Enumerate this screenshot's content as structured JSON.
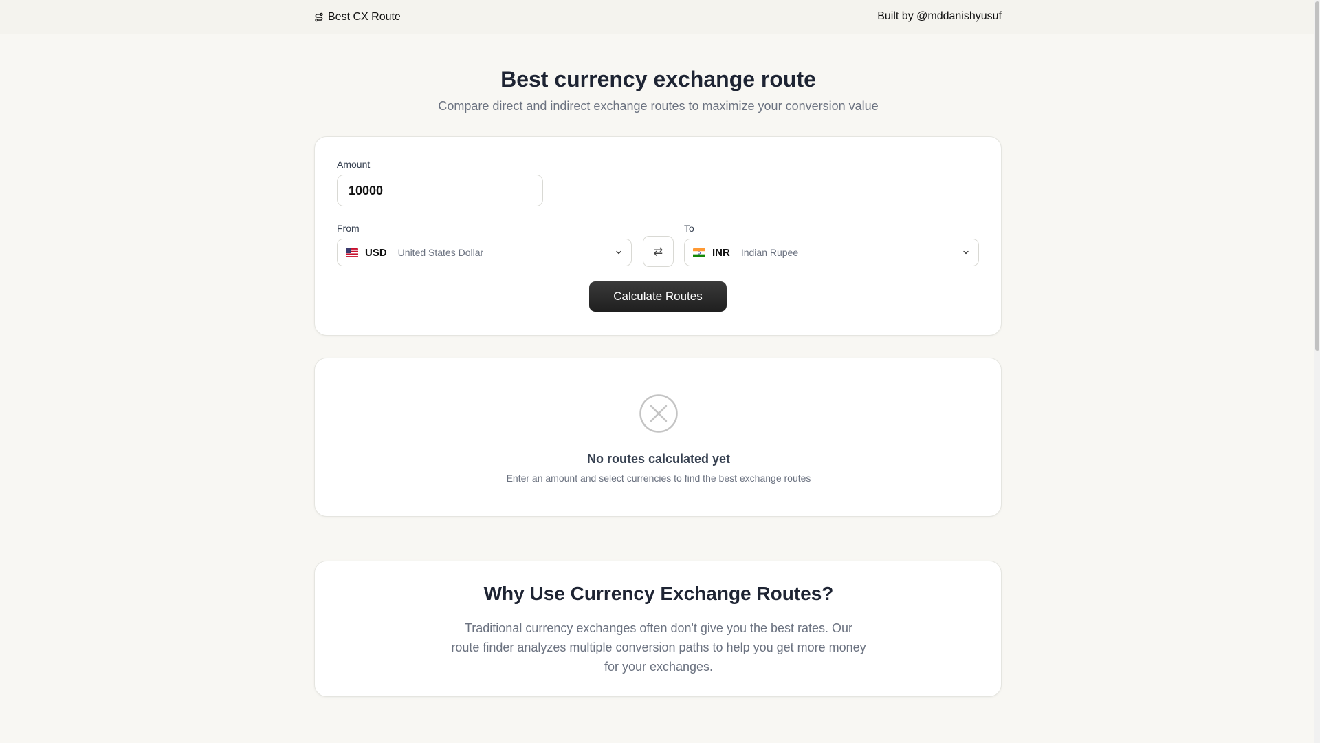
{
  "header": {
    "brand": "Best CX Route",
    "credit": "Built by @mddanishyusuf"
  },
  "hero": {
    "title": "Best currency exchange route",
    "subtitle": "Compare direct and indirect exchange routes to maximize your conversion value"
  },
  "form": {
    "amount_label": "Amount",
    "amount_value": "10000",
    "from_label": "From",
    "from_code": "USD",
    "from_name": "United States Dollar",
    "to_label": "To",
    "to_code": "INR",
    "to_name": "Indian Rupee",
    "swap_icon": "swap-arrows-icon",
    "calculate_label": "Calculate Routes"
  },
  "empty_state": {
    "icon": "x-circle-icon",
    "title": "No routes calculated yet",
    "subtitle": "Enter an amount and select currencies to find the best exchange routes"
  },
  "why": {
    "title": "Why Use Currency Exchange Routes?",
    "text": "Traditional currency exchanges often don't give you the best rates. Our route finder analyzes multiple conversion paths to help you get more money for your exchanges."
  },
  "colors": {
    "background": "#f8f7f3",
    "button": "#2a2a2a",
    "muted_text": "#6b7280"
  }
}
